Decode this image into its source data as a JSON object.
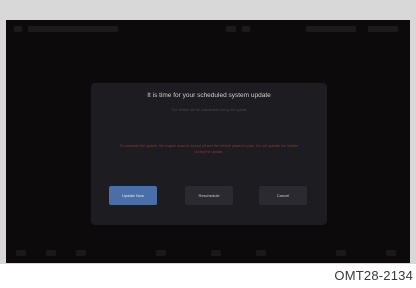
{
  "dialog": {
    "title": "It is time for your scheduled system update",
    "subtitle": "The vehicle will be unavailable during the update",
    "warning": "To complete the update, the engine must be turned off and the vehicle placed in park. Do not operate the vehicle during the update.",
    "buttons": {
      "update_now": "Update Now",
      "reschedule": "Reschedule",
      "cancel": "Cancel"
    }
  },
  "figure_code": "OMT28-2134",
  "colors": {
    "screen_background": "#0c0a0b",
    "dialog_background": "#1d1c20",
    "primary_button": "#4a6ea8",
    "warning_text": "#8a3a34"
  }
}
